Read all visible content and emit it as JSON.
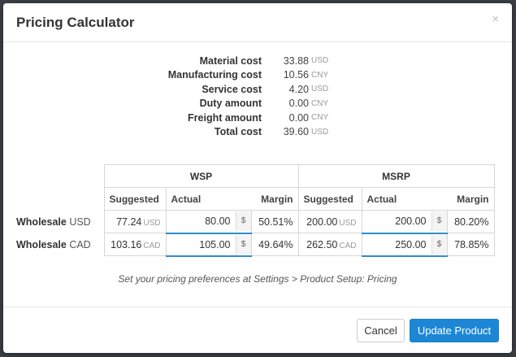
{
  "title": "Pricing Calculator",
  "close_glyph": "×",
  "costs": [
    {
      "label": "Material cost",
      "value": "33.88",
      "currency": "USD"
    },
    {
      "label": "Manufacturing cost",
      "value": "10.56",
      "currency": "CNY"
    },
    {
      "label": "Service cost",
      "value": "4.20",
      "currency": "USD"
    },
    {
      "label": "Duty amount",
      "value": "0.00",
      "currency": "CNY"
    },
    {
      "label": "Freight amount",
      "value": "0.00",
      "currency": "CNY"
    },
    {
      "label": "Total cost",
      "value": "39.60",
      "currency": "USD"
    }
  ],
  "table": {
    "groups": [
      "WSP",
      "MSRP"
    ],
    "subheaders": [
      "Suggested",
      "Actual",
      "Margin",
      "Suggested",
      "Actual",
      "Margin"
    ],
    "currency_symbol": "$",
    "rows": [
      {
        "label": "Wholesale",
        "currency": "USD",
        "wsp": {
          "suggested": "77.24",
          "suggested_cur": "USD",
          "actual": "80.00",
          "margin": "50.51%"
        },
        "msrp": {
          "suggested": "200.00",
          "suggested_cur": "USD",
          "actual": "200.00",
          "margin": "80.20%"
        }
      },
      {
        "label": "Wholesale",
        "currency": "CAD",
        "wsp": {
          "suggested": "103.16",
          "suggested_cur": "CAD",
          "actual": "105.00",
          "margin": "49.64%"
        },
        "msrp": {
          "suggested": "262.50",
          "suggested_cur": "CAD",
          "actual": "250.00",
          "margin": "78.85%"
        }
      }
    ]
  },
  "hint": "Set your pricing preferences at Settings > Product Setup: Pricing",
  "footer": {
    "cancel_label": "Cancel",
    "primary_label": "Update Product"
  }
}
